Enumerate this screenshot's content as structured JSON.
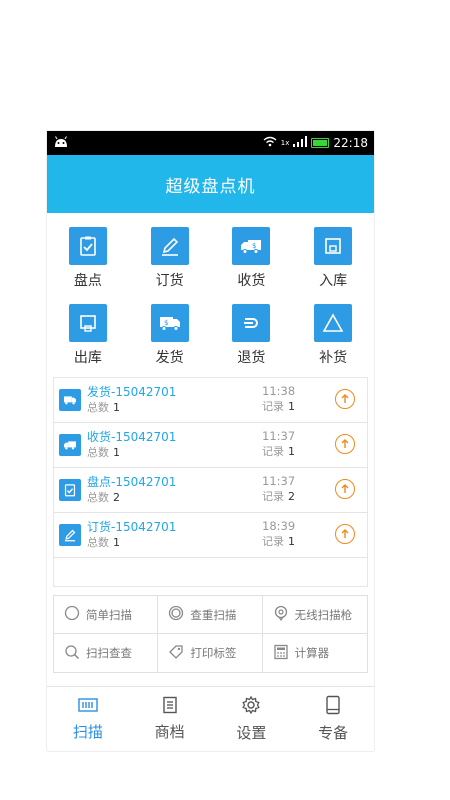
{
  "status": {
    "time": "22:18",
    "network": "1x"
  },
  "app": {
    "title": "超级盘点机"
  },
  "tiles": [
    {
      "label": "盘点",
      "icon": "clipboard-check-icon"
    },
    {
      "label": "订货",
      "icon": "pen-icon"
    },
    {
      "label": "收货",
      "icon": "truck-receive-icon"
    },
    {
      "label": "入库",
      "icon": "inbox-icon"
    },
    {
      "label": "出库",
      "icon": "outbox-icon"
    },
    {
      "label": "发货",
      "icon": "truck-send-icon"
    },
    {
      "label": "退货",
      "icon": "return-icon"
    },
    {
      "label": "补货",
      "icon": "triangle-icon"
    }
  ],
  "records": [
    {
      "title": "发货-15042701",
      "total_label": "总数",
      "total": "1",
      "time": "11:38",
      "record_label": "记录",
      "record": "1",
      "icon": "truck-send-icon"
    },
    {
      "title": "收货-15042701",
      "total_label": "总数",
      "total": "1",
      "time": "11:37",
      "record_label": "记录",
      "record": "1",
      "icon": "truck-receive-icon"
    },
    {
      "title": "盘点-15042701",
      "total_label": "总数",
      "total": "2",
      "time": "11:37",
      "record_label": "记录",
      "record": "2",
      "icon": "clipboard-check-icon"
    },
    {
      "title": "订货-15042701",
      "total_label": "总数",
      "total": "1",
      "time": "18:39",
      "record_label": "记录",
      "record": "1",
      "icon": "pen-icon"
    }
  ],
  "tools": [
    {
      "label": "简单扫描",
      "icon": "circle-icon"
    },
    {
      "label": "查重扫描",
      "icon": "double-circle-icon"
    },
    {
      "label": "无线扫描枪",
      "icon": "scanner-icon"
    },
    {
      "label": "扫扫查查",
      "icon": "search-icon"
    },
    {
      "label": "打印标签",
      "icon": "tag-icon"
    },
    {
      "label": "计算器",
      "icon": "calculator-icon"
    }
  ],
  "nav": [
    {
      "label": "扫描",
      "icon": "barcode-icon",
      "active": true
    },
    {
      "label": "商档",
      "icon": "document-icon",
      "active": false
    },
    {
      "label": "设置",
      "icon": "gear-icon",
      "active": false
    },
    {
      "label": "专备",
      "icon": "device-icon",
      "active": false
    }
  ],
  "colors": {
    "primary": "#22b7ea",
    "tile": "#2e9be5",
    "accent": "#f08a1c",
    "title_text": "#22a7e6",
    "nav_active": "#2b8fe0"
  }
}
